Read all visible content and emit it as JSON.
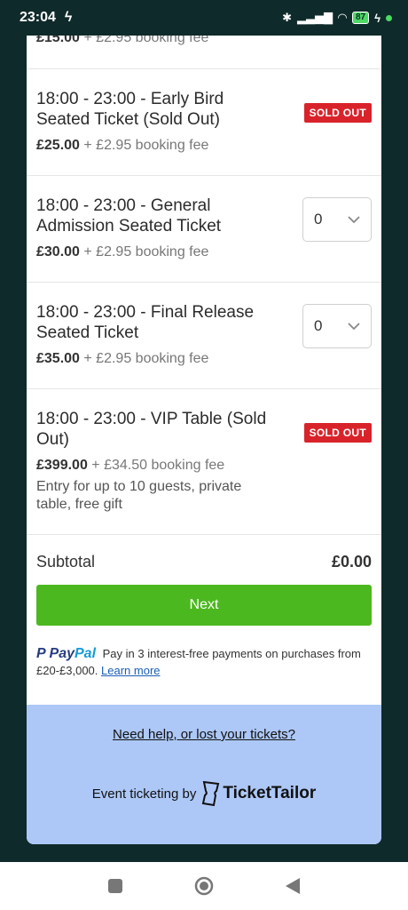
{
  "status_bar": {
    "time": "23:04",
    "battery": "87"
  },
  "top_partial": {
    "price": "£15.00",
    "fee": "+ £2.95 booking fee"
  },
  "tickets": [
    {
      "title": "18:00 - 23:00 - Early Bird Seated Ticket (Sold Out)",
      "price": "£25.00",
      "fee": "+ £2.95 booking fee",
      "status": "SOLD OUT"
    },
    {
      "title": "18:00 - 23:00 - General Admission Seated Ticket",
      "price": "£30.00",
      "fee": "+ £2.95 booking fee",
      "quantity": "0"
    },
    {
      "title": "18:00 - 23:00 - Final Release Seated Ticket",
      "price": "£35.00",
      "fee": "+ £2.95 booking fee",
      "quantity": "0"
    },
    {
      "title": "18:00 - 23:00 - VIP Table (Sold Out)",
      "price": "£399.00",
      "fee": "+ £34.50 booking fee",
      "description": "Entry for up to 10 guests, private table, free gift",
      "status": "SOLD OUT"
    }
  ],
  "subtotal": {
    "label": "Subtotal",
    "value": "£0.00"
  },
  "next_button": "Next",
  "paypal": {
    "logo_pay": "Pay",
    "logo_pal": "Pal",
    "text": "Pay in 3 interest-free payments on purchases from £20-£3,000.",
    "link": "Learn more"
  },
  "footer": {
    "help_link": "Need help, or lost your tickets?",
    "ticketing_by": "Event ticketing by",
    "brand": "TicketTailor"
  },
  "colors": {
    "background": "#0f2a2a",
    "accent_green": "#4cb81f",
    "sold_out_red": "#d9232b",
    "footer_blue": "#adc8f7"
  }
}
